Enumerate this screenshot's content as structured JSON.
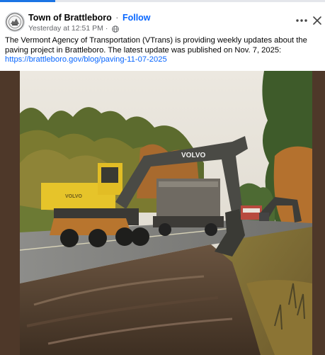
{
  "post": {
    "page_name": "Town of Brattleboro",
    "separator": "·",
    "follow_label": "Follow",
    "timestamp": "Yesterday at 12:51 PM",
    "meta_separator": "·",
    "body_text": "The Vermont Agency of Transportation (VTrans) is providing weekly updates about the paving project in Brattleboro. The latest update was published on Nov. 7, 2025: ",
    "link_text": "https://brattleboro.gov/blog/paving-11-07-2025",
    "audience_icon": "globe-icon"
  },
  "header_actions": {
    "more_icon": "more-options-icon",
    "close_icon": "close-icon"
  },
  "photo": {
    "excavator_brand": "VOLVO",
    "excavator_side_brand": "VOLVO"
  },
  "colors": {
    "link": "#0866ff",
    "meta": "#65676b",
    "tab_accent": "#1b74e4",
    "photo_border": "#4e3829"
  }
}
